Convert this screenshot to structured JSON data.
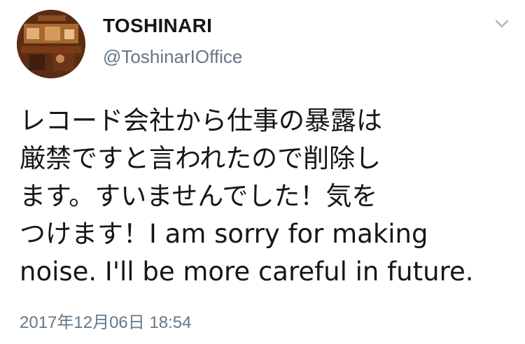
{
  "tweet": {
    "display_name": "TOSHINARI",
    "handle": "@ToshinarIOffice",
    "body_lines": [
      "レコード会社から仕事の暴露は",
      "厳禁ですと言われたので削除し",
      "ます。すいませんでした！気を",
      "つけます！I am sorry for making",
      "noise. I'll be more careful in future."
    ],
    "timestamp": "2017年12月06日 18:54",
    "menu_icon": "chevron-down-icon",
    "avatar_icon": "avatar-photo"
  },
  "colors": {
    "text_primary": "#14171a",
    "text_secondary": "#657786",
    "background": "#ffffff"
  }
}
